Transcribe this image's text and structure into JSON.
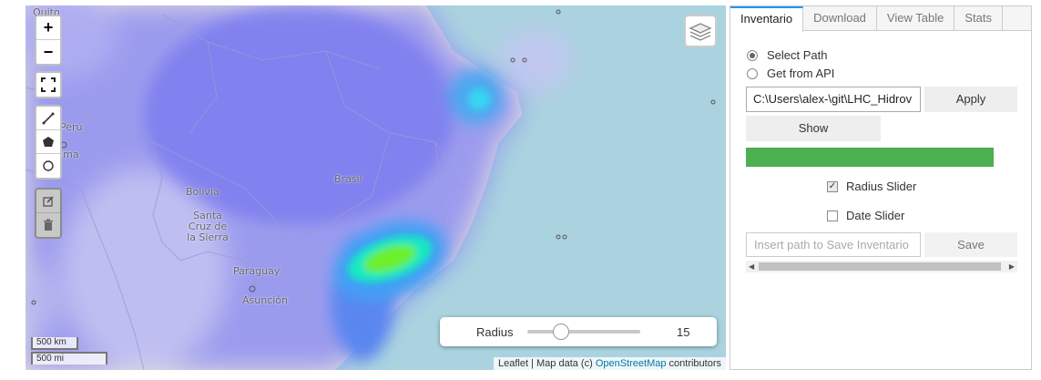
{
  "map": {
    "labels": {
      "quito": "Quito",
      "peru": "Perú",
      "lima": "Lima",
      "bolivia": "Bolivia",
      "santa_cruz": "Santa Cruz de la Sierra",
      "brasil": "Brasil",
      "paraguay": "Paraguay",
      "asuncion": "Asunción"
    },
    "controls": {
      "zoom_in": "+",
      "zoom_out": "−",
      "fullscreen_icon": "fullscreen-icon",
      "polyline_icon": "polyline-icon",
      "polygon_icon": "polygon-icon",
      "circle_icon": "circle-icon",
      "edit_icon": "edit-icon",
      "delete_icon": "trash-icon",
      "layers_icon": "layers-icon"
    },
    "scale": {
      "km": "500 km",
      "mi": "500 mi"
    },
    "attribution": {
      "leaflet": "Leaflet",
      "separator": " | Map data (c) ",
      "osm": "OpenStreetMap",
      "suffix": " contributors"
    },
    "radius": {
      "label": "Radius",
      "value": "15",
      "fraction": 0.3
    }
  },
  "panel": {
    "tabs": [
      "Inventario",
      "Download",
      "View Table",
      "Stats"
    ],
    "active_tab": "Inventario",
    "radio": {
      "select_path": "Select Path",
      "from_api": "Get from API"
    },
    "path_value": "C:\\Users\\alex-\\git\\LHC_Hidrov",
    "apply": "Apply",
    "show": "Show",
    "progress": 1.0,
    "progress_color": "#4caf50",
    "radius_slider": "Radius Slider",
    "date_slider": "Date Slider",
    "save_placeholder": "Insert path to Save Inventario",
    "save": "Save"
  }
}
